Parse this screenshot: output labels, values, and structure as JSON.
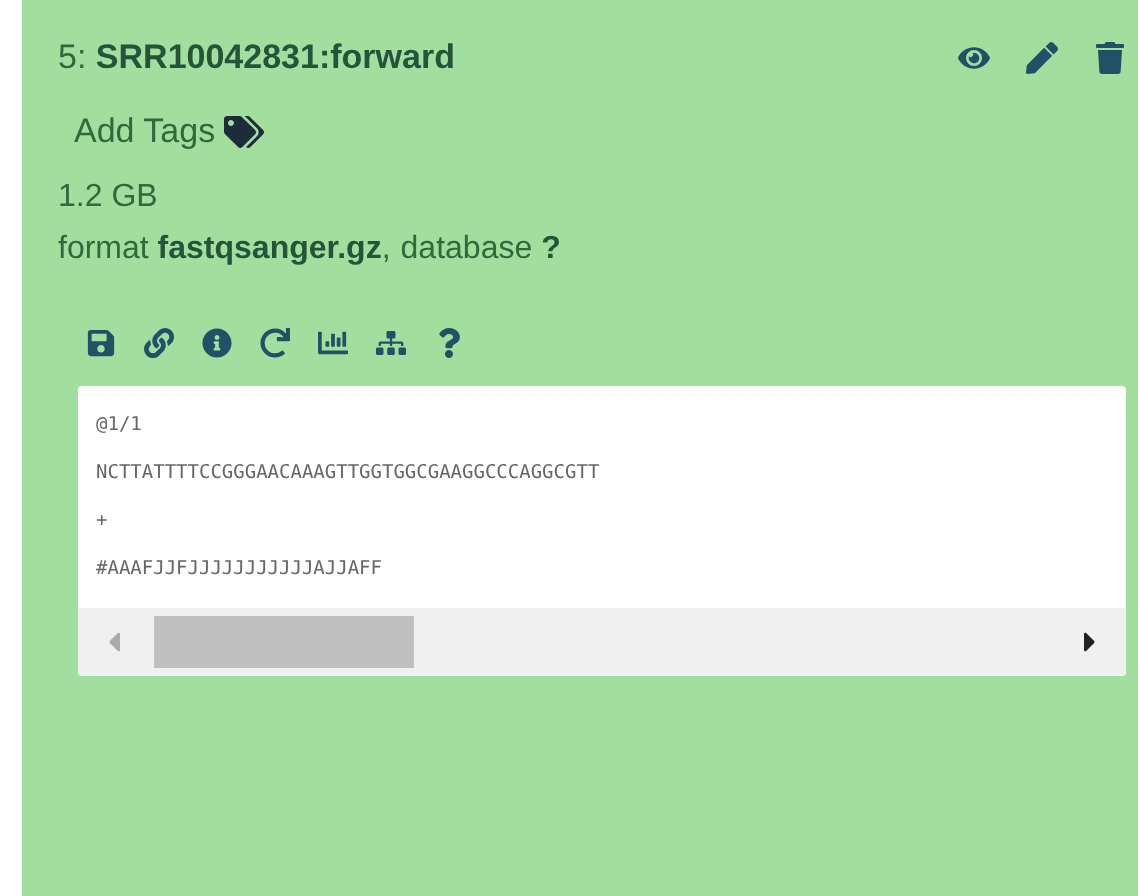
{
  "dataset": {
    "hid": "5:",
    "name": "SRR10042831:forward"
  },
  "tags": {
    "label": "Add Tags"
  },
  "size": "1.2 GB",
  "format": {
    "label": "format",
    "value": "fastqsanger.gz",
    "separator": ",",
    "db_label": "database",
    "db_value": "?"
  },
  "peek": {
    "lines": [
      "@1/1",
      "NCTTATTTTCCGGGAACAAAGTTGGTGGCGAAGGCCCAGGCGTT",
      "+",
      "#AAAFJJFJJJJJJJJJJJAJJAFF"
    ]
  }
}
